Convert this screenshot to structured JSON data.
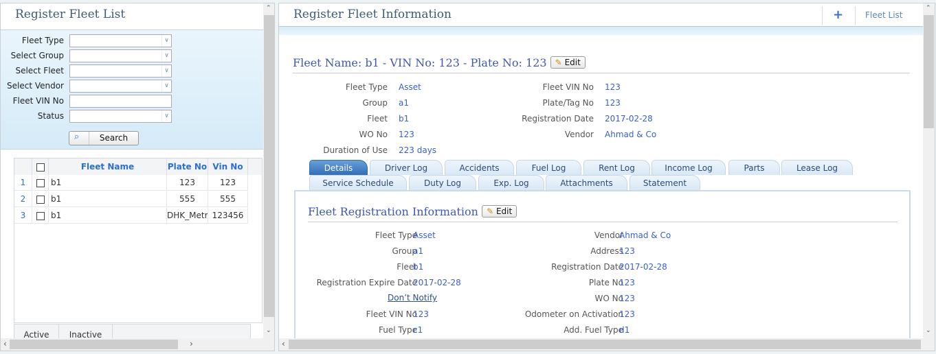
{
  "left": {
    "title": "Register Fleet List",
    "filters": [
      {
        "label": "Fleet Type",
        "type": "select",
        "value": ""
      },
      {
        "label": "Select Group",
        "type": "select",
        "value": ""
      },
      {
        "label": "Select Fleet",
        "type": "select",
        "value": ""
      },
      {
        "label": "Select Vendor",
        "type": "select",
        "value": ""
      },
      {
        "label": "Fleet VIN No",
        "type": "text",
        "value": ""
      },
      {
        "label": "Status",
        "type": "select",
        "value": ""
      }
    ],
    "search_label": "Search",
    "grid": {
      "columns": [
        "Fleet Name",
        "Plate No",
        "Vin No"
      ],
      "rows": [
        {
          "num": "1",
          "name": "b1",
          "plate": "123",
          "vin": "123"
        },
        {
          "num": "2",
          "name": "b1",
          "plate": "555",
          "vin": "555"
        },
        {
          "num": "3",
          "name": "b1",
          "plate": "DHK_Metro",
          "vin": "123456"
        }
      ]
    },
    "status_tabs": [
      "Active",
      "Inactive"
    ]
  },
  "right": {
    "title": "Register Fleet Information",
    "add_icon": "plus-icon",
    "fleet_list_label": "Fleet List",
    "heading": "Fleet Name: b1 - VIN No: 123 - Plate No: 123",
    "edit_label": "Edit",
    "summary_left": [
      {
        "label": "Fleet Type",
        "value": "Asset"
      },
      {
        "label": "Group",
        "value": "a1"
      },
      {
        "label": "Fleet",
        "value": "b1"
      },
      {
        "label": "WO No",
        "value": "123"
      },
      {
        "label": "Duration of Use",
        "value": "223 days"
      }
    ],
    "summary_right": [
      {
        "label": "Fleet VIN No",
        "value": "123"
      },
      {
        "label": "Plate/Tag No",
        "value": "123"
      },
      {
        "label": "Registration Date",
        "value": "2017-02-28"
      },
      {
        "label": "Vendor",
        "value": "Ahmad & Co"
      }
    ],
    "tabs_row1": [
      "Details",
      "Driver Log",
      "Accidents",
      "Fuel Log",
      "Rent Log",
      "Income Log",
      "Parts",
      "Lease Log"
    ],
    "tabs_row2": [
      "Service Schedule",
      "Duty Log",
      "Exp. Log",
      "Attachments",
      "Statement"
    ],
    "active_tab": "Details",
    "section": {
      "title": "Fleet Registration Information",
      "edit_label": "Edit",
      "left": [
        {
          "label": "Fleet Type",
          "value": "Asset"
        },
        {
          "label": "Group",
          "value": "a1"
        },
        {
          "label": "Fleet",
          "value": "b1"
        },
        {
          "label": "Registration Expire Date",
          "value": "2017-02-28"
        },
        {
          "label": "",
          "value": ""
        },
        {
          "label": "Fleet VIN No",
          "value": "123"
        },
        {
          "label": "Fuel Type",
          "value": "c1"
        }
      ],
      "dont_notify": "Don’t Notify",
      "right": [
        {
          "label": "Vendor",
          "value": "Ahmad & Co"
        },
        {
          "label": "Address",
          "value": "123"
        },
        {
          "label": "Registration Date",
          "value": "2017-02-28"
        },
        {
          "label": "Plate No",
          "value": "123"
        },
        {
          "label": "WO No",
          "value": "123"
        },
        {
          "label": "Odometer on Activation",
          "value": "123"
        },
        {
          "label": "Add. Fuel Type",
          "value": "d1"
        }
      ]
    }
  }
}
